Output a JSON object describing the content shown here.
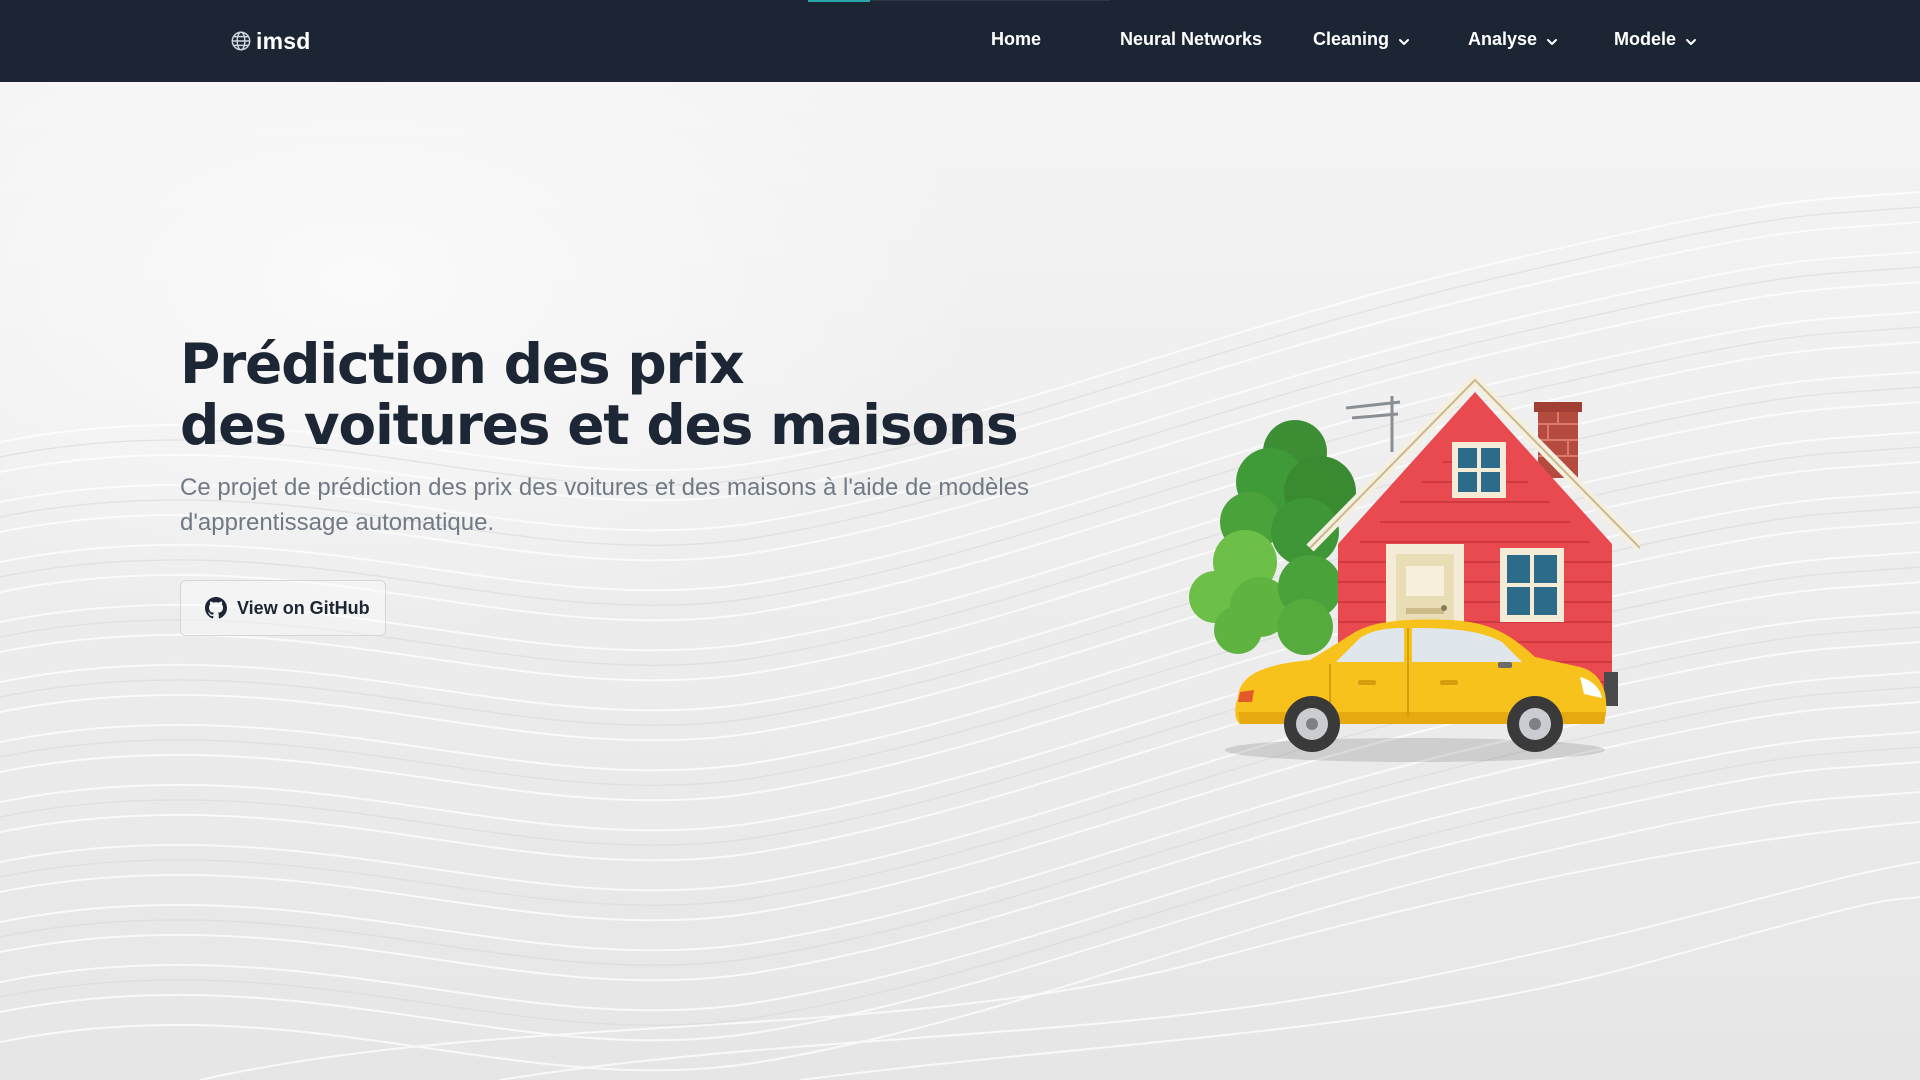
{
  "brand": {
    "name": "imsd",
    "icon": "globe-icon"
  },
  "nav": {
    "items": [
      {
        "label": "Home",
        "has_dropdown": false
      },
      {
        "label": "Neural Networks",
        "has_dropdown": false
      },
      {
        "label": "Cleaning",
        "has_dropdown": true
      },
      {
        "label": "Analyse",
        "has_dropdown": true
      },
      {
        "label": "Modele",
        "has_dropdown": true
      }
    ],
    "dropdown_icon": "chevron-down-icon"
  },
  "hero": {
    "title_line1": "Prédiction des prix",
    "title_line2": "des voitures et des maisons",
    "description": "Ce projet de prédiction des prix des voitures et des maisons à l'aide de modèles d'apprentissage automatique.",
    "button": {
      "label": "View on GitHub",
      "icon": "github-icon"
    },
    "illustration": "house-and-car-illustration"
  },
  "colors": {
    "navbar_bg": "#1b2533",
    "nav_accent": "#2aa6a8",
    "title_text": "#1c2634",
    "description_text": "#707a86",
    "house_wall": "#e84a4f",
    "car_body": "#f8c21c",
    "tree": "#4aa33a"
  }
}
